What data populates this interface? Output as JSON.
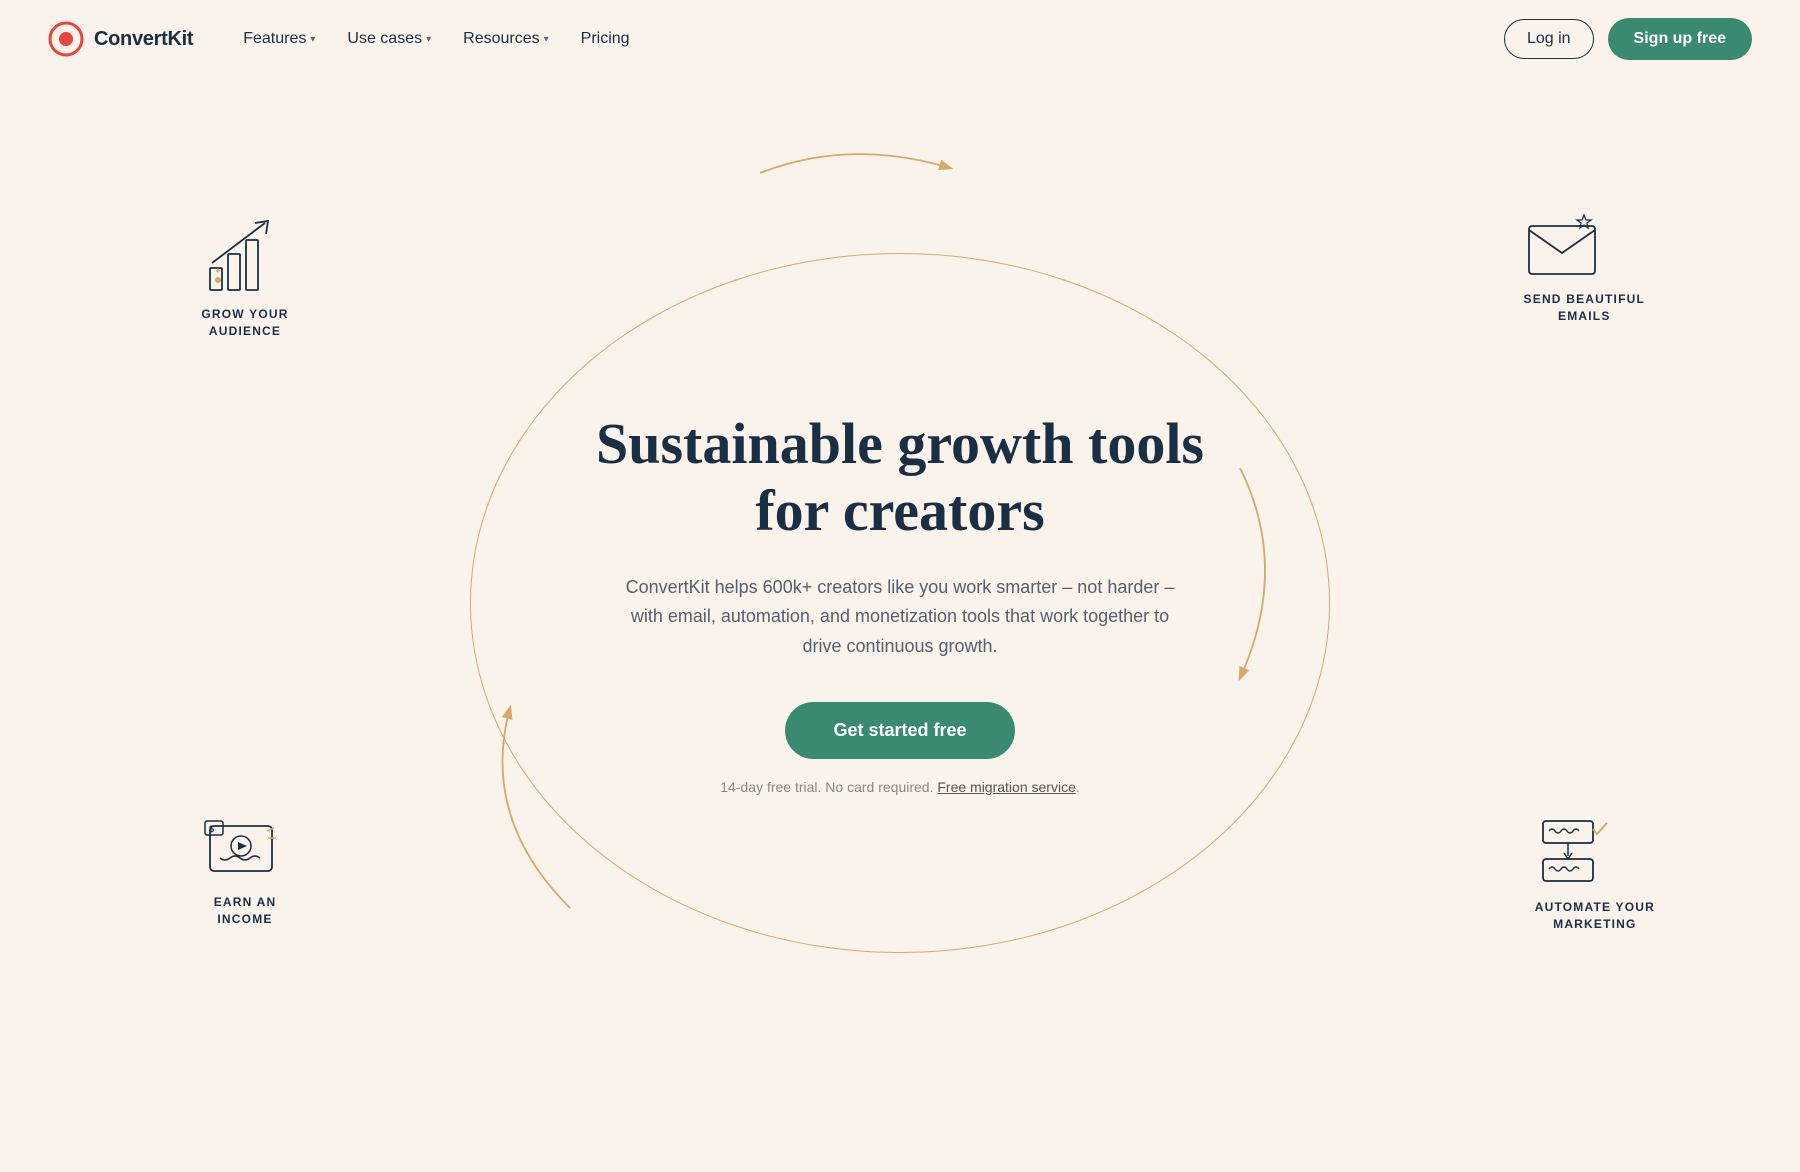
{
  "nav": {
    "logo_text": "ConvertKit",
    "links": [
      {
        "label": "Features",
        "has_dropdown": true
      },
      {
        "label": "Use cases",
        "has_dropdown": true
      },
      {
        "label": "Resources",
        "has_dropdown": true
      },
      {
        "label": "Pricing",
        "has_dropdown": false
      }
    ],
    "login_label": "Log in",
    "signup_label": "Sign up free"
  },
  "hero": {
    "title": "Sustainable growth tools for creators",
    "subtitle": "ConvertKit helps 600k+ creators like you work smarter – not harder – with email, automation, and monetization tools that work together to drive continuous growth.",
    "cta_label": "Get started free",
    "footnote_text": "14-day free trial. No card required.",
    "migration_link": "Free migration service",
    "footnote_end": ".",
    "features": [
      {
        "id": "grow",
        "label": "GROW YOUR\nAUDIENCE"
      },
      {
        "id": "email",
        "label": "SEND BEAUTIFUL\nEMAILS"
      },
      {
        "id": "earn",
        "label": "EARN AN\nINCOME"
      },
      {
        "id": "automate",
        "label": "AUTOMATE YOUR\nMARKETING"
      }
    ]
  },
  "colors": {
    "primary": "#1a2e44",
    "accent_green": "#3a8a72",
    "accent_gold": "#d4a96a",
    "bg": "#f9f3ec",
    "text_muted": "#888888"
  }
}
